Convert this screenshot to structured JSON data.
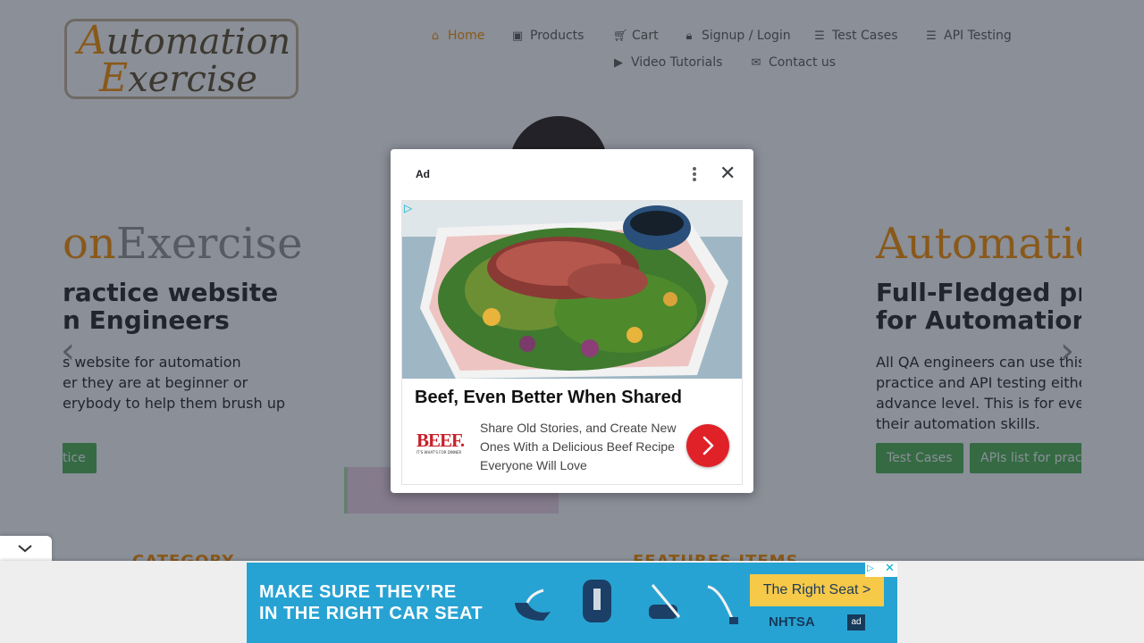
{
  "logo": {
    "line1": "Automation",
    "line2": "Exercise"
  },
  "nav": {
    "home": "Home",
    "products": "Products",
    "cart": "Cart",
    "signup": "Signup / Login",
    "test_cases": "Test Cases",
    "api_testing": "API Testing",
    "video": "Video Tutorials",
    "contact": "Contact us"
  },
  "slider": {
    "left": {
      "brand_orange": "on",
      "brand_grey": "Exercise",
      "heading_1": "ractice website",
      "heading_2": "n Engineers",
      "p1": "s website for automation",
      "p2": "er they are at beginner or",
      "p3": "erybody to help them brush up",
      "button": "tice"
    },
    "right": {
      "brand_orange": "Automatio",
      "heading_1": "Full-Fledged pr",
      "heading_2": "for Automation",
      "p1": "All QA engineers can use this",
      "p2": "practice and API testing eithe",
      "p3": "advance level. This is for eve",
      "p4": "their automation skills.",
      "button_1": "Test Cases",
      "button_2": "APIs list for prac"
    },
    "prev_icon": "chevron-left-icon",
    "next_icon": "chevron-right-icon"
  },
  "below": {
    "category": "CATEGORY",
    "features": "FEATURES ITEMS"
  },
  "modal_ad": {
    "label": "Ad",
    "headline": "Beef, Even Better When Shared",
    "body": "Share Old Stories, and Create New Ones With a Delicious Beef Recipe Everyone Will Love",
    "brand_logo": "BEEF.",
    "brand_tagline": "IT'S WHAT'S FOR DINNER",
    "cta_icon": "chevron-right-icon"
  },
  "banner_ad": {
    "line1": "MAKE SURE THEY’RE",
    "line2": "IN THE RIGHT CAR SEAT",
    "cta": "The Right Seat >",
    "org": "NHTSA",
    "mark": "ad"
  },
  "colors": {
    "accent": "#fe980f",
    "button_green": "#5cb85c",
    "ad_red": "#e02128",
    "banner_blue": "#27a3d3",
    "banner_yellow": "#f7c948"
  }
}
